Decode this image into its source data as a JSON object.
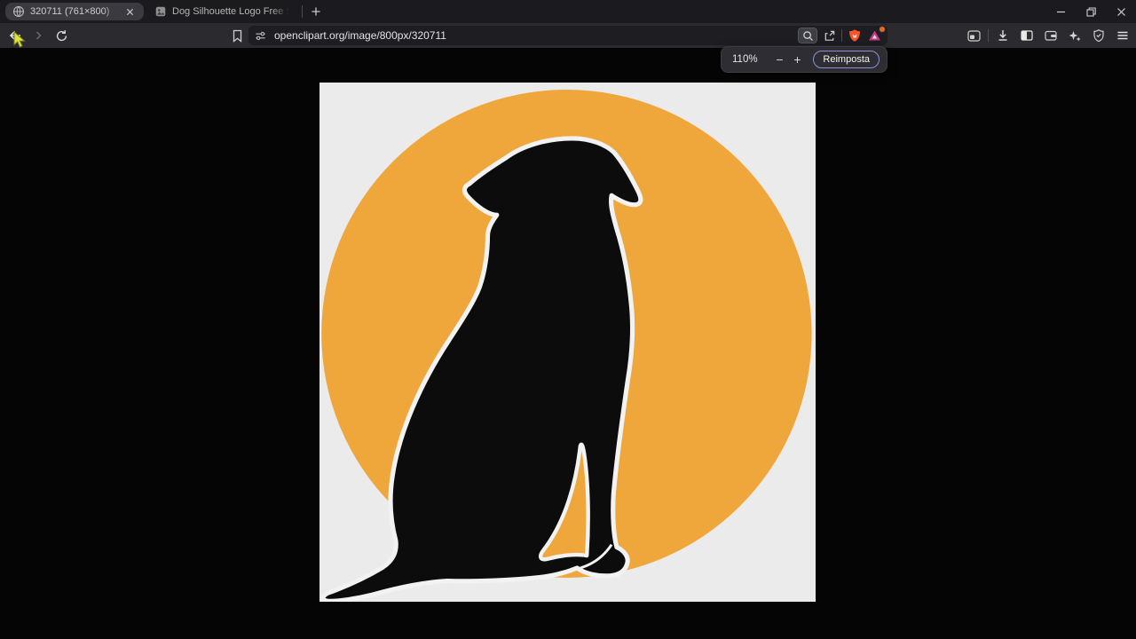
{
  "browser": {
    "tabs": [
      {
        "title": "320711 (761×800)"
      },
      {
        "title": "Dog Silhouette Logo Free Stock Phot"
      }
    ],
    "url": "openclipart.org/image/800px/320711"
  },
  "zoom_popup": {
    "level": "110%",
    "minus_label": "−",
    "plus_label": "+",
    "reset_label": "Reimposta"
  },
  "image_page": {
    "subject": "sitting dog silhouette inside orange circle",
    "canvas_background": "#ebebeb",
    "circle_color": "#efa73c",
    "silhouette_color": "#0c0c0c",
    "outline_color": "#f2f2f2"
  },
  "colors": {
    "shields_orange": "#fb542b",
    "rewards_magenta": "#c23d82",
    "notification_badge": "#ef6420",
    "reset_button_border": "#8a93d8",
    "cursor_yellow": "#dde23c"
  }
}
